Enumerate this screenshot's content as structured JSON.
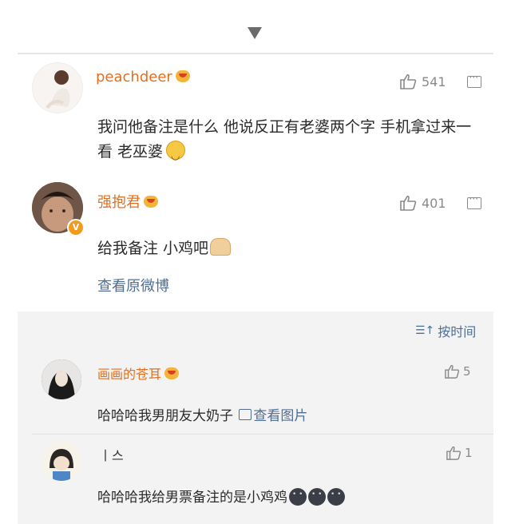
{
  "comments": [
    {
      "username": "peachdeer",
      "likes": "541",
      "text": "我问他备注是什么 他说反正有老婆两个字 手机拿过来一看 老巫婆",
      "emoji": "smile-emoji"
    },
    {
      "username": "强抱君",
      "likes": "401",
      "text": "给我备注 小鸡吧",
      "emoji": "clap-emoji",
      "view_original": "查看原微博"
    }
  ],
  "sub_section": {
    "sort_label": "按时间",
    "replies": [
      {
        "username": "画画的苍耳",
        "likes": "5",
        "text": "哈哈哈我男朋友大奶子",
        "image_link": "查看图片"
      },
      {
        "username": "丨스",
        "likes": "1",
        "text": "哈哈哈我给男票备注的是小鸡鸡"
      }
    ]
  },
  "colors": {
    "username": "#e46f1e",
    "link": "#4f6e93",
    "background_gray": "#f3f3f3",
    "text": "#2b2b2b",
    "meta": "#8a8a8a"
  }
}
